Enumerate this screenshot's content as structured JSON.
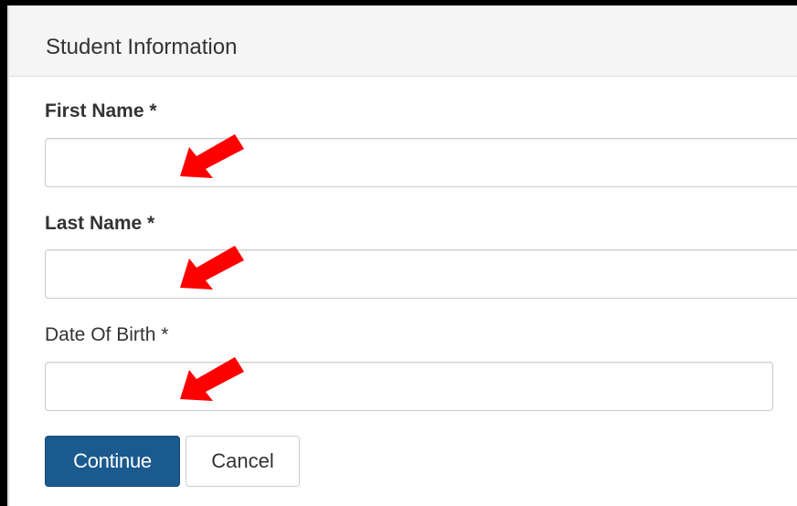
{
  "panel": {
    "title": "Student Information"
  },
  "form": {
    "first_name": {
      "label": "First Name *",
      "value": ""
    },
    "last_name": {
      "label": "Last Name *",
      "value": ""
    },
    "date_of_birth": {
      "label": "Date Of Birth *",
      "value": ""
    }
  },
  "buttons": {
    "continue_label": "Continue",
    "cancel_label": "Cancel"
  },
  "annotations": {
    "arrow_color": "#ff0000",
    "arrow_icon": "red-arrow-icon"
  },
  "colors": {
    "primary_button": "#1a5a8e",
    "panel_heading_bg": "#f5f5f5"
  }
}
